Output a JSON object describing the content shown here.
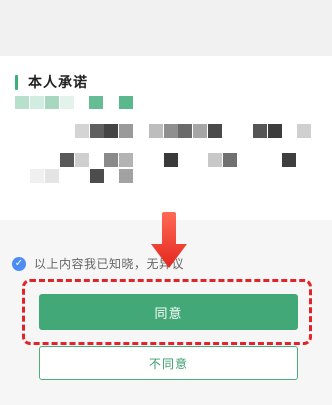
{
  "card": {
    "section_title": "本人承诺"
  },
  "footer": {
    "consent_text": "以上内容我已知晓，无异议",
    "agree_label": "同意",
    "disagree_label": "不同意"
  },
  "colors": {
    "primary_green": "#42a877",
    "check_blue": "#4b8df2",
    "annotation_red": "#e0252a"
  },
  "icons": [
    "check-circle-icon",
    "down-arrow-icon"
  ]
}
